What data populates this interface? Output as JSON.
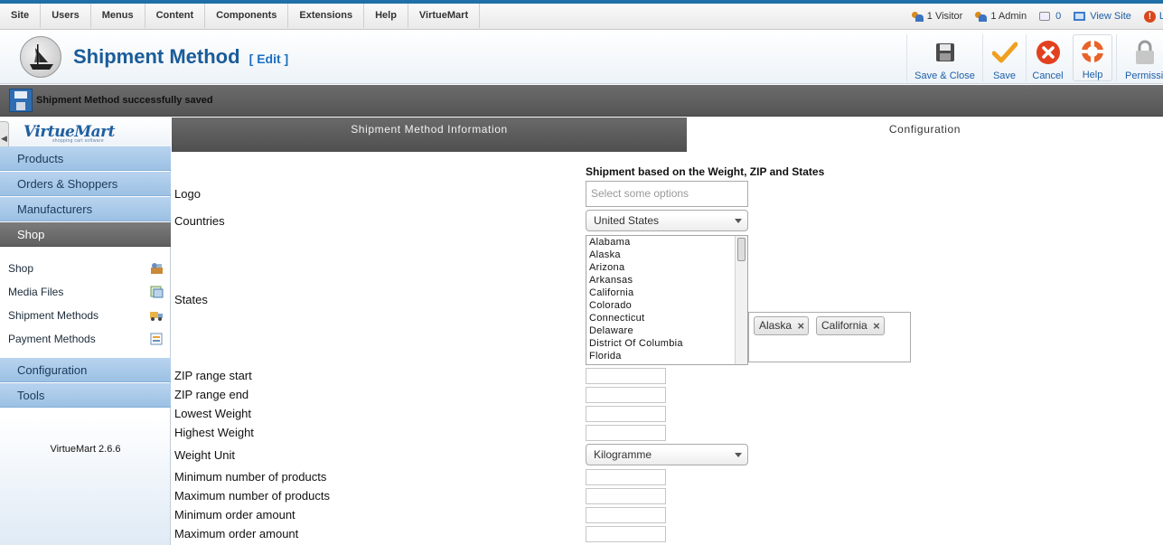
{
  "topmenu": [
    "Site",
    "Users",
    "Menus",
    "Content",
    "Components",
    "Extensions",
    "Help",
    "VirtueMart"
  ],
  "status": {
    "visitors": "1 Visitor",
    "admins": "1 Admin",
    "messages": "0",
    "view_site": "View Site",
    "logout": "L"
  },
  "header": {
    "title": "Shipment Method",
    "edit": "[ Edit ]"
  },
  "toolbar": {
    "save_close": "Save & Close",
    "save": "Save",
    "cancel": "Cancel",
    "help": "Help",
    "permissions": "Permissions"
  },
  "message": "Shipment Method successfully saved",
  "sidebar": {
    "logo": "VirtueMart",
    "logo_sub": "shopping cart software",
    "headers": [
      "Products",
      "Orders & Shoppers",
      "Manufacturers",
      "Shop"
    ],
    "shop_items": [
      "Shop",
      "Media Files",
      "Shipment Methods",
      "Payment Methods"
    ],
    "bottom_headers": [
      "Configuration",
      "Tools"
    ],
    "version": "VirtueMart 2.6.6"
  },
  "tabs": {
    "info": "Shipment Method Information",
    "config": "Configuration"
  },
  "form": {
    "section_title": "Shipment based on the Weight, ZIP and States",
    "logo_label": "Logo",
    "logo_placeholder": "Select some options",
    "countries_label": "Countries",
    "countries_value": "United States",
    "states_label": "States",
    "states_options": [
      "Alabama",
      "Alaska",
      "Arizona",
      "Arkansas",
      "California",
      "Colorado",
      "Connecticut",
      "Delaware",
      "District Of Columbia",
      "Florida"
    ],
    "states_selected": [
      "Alaska",
      "California"
    ],
    "zip_start_label": "ZIP range start",
    "zip_end_label": "ZIP range end",
    "lowest_weight_label": "Lowest Weight",
    "highest_weight_label": "Highest Weight",
    "weight_unit_label": "Weight Unit",
    "weight_unit_value": "Kilogramme",
    "min_products_label": "Minimum number of products",
    "max_products_label": "Maximum number of products",
    "min_amount_label": "Minimum order amount",
    "max_amount_label": "Maximum order amount"
  }
}
